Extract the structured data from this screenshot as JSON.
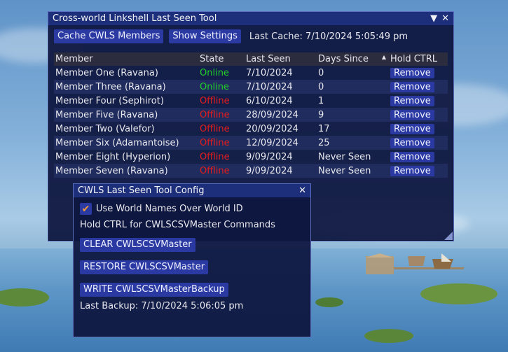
{
  "main_window": {
    "title": "Cross-world Linkshell Last Seen Tool",
    "cache_button": "Cache CWLS Members",
    "settings_button": "Show Settings",
    "last_cache": "Last Cache: 7/10/2024 5:05:49 pm",
    "columns": [
      "Member",
      "State",
      "Last Seen",
      "Days Since",
      "Hold CTRL"
    ],
    "rows": [
      {
        "member": "Member One (Ravana)",
        "state": "Online",
        "last_seen": "7/10/2024",
        "days_since": "0",
        "action": "Remove"
      },
      {
        "member": "Member Three (Ravana)",
        "state": "Online",
        "last_seen": "7/10/2024",
        "days_since": "0",
        "action": "Remove"
      },
      {
        "member": "Member Four (Sephirot)",
        "state": "Offline",
        "last_seen": "6/10/2024",
        "days_since": "1",
        "action": "Remove"
      },
      {
        "member": "Member Five (Ravana)",
        "state": "Offline",
        "last_seen": "28/09/2024",
        "days_since": "9",
        "action": "Remove"
      },
      {
        "member": "Member Two (Valefor)",
        "state": "Offline",
        "last_seen": "20/09/2024",
        "days_since": "17",
        "action": "Remove"
      },
      {
        "member": "Member Six (Adamantoise)",
        "state": "Offline",
        "last_seen": "12/09/2024",
        "days_since": "25",
        "action": "Remove"
      },
      {
        "member": "Member Eight (Hyperion)",
        "state": "Offline",
        "last_seen": "9/09/2024",
        "days_since": "Never Seen",
        "action": "Remove"
      },
      {
        "member": "Member Seven (Ravana)",
        "state": "Offline",
        "last_seen": "9/09/2024",
        "days_since": "Never Seen",
        "action": "Remove"
      }
    ]
  },
  "config_window": {
    "title": "CWLS Last Seen Tool Config",
    "checkbox_label": "Use World Names Over World ID",
    "checkbox_checked": true,
    "hint": "Hold CTRL for CWLSCSVMaster Commands",
    "clear_button": "CLEAR CWLSCSVMaster",
    "restore_button": "RESTORE CWLSCSVMaster",
    "write_button": "WRITE CWLSCSVMasterBackup",
    "last_backup": "Last Backup: 7/10/2024 5:06:05 pm"
  },
  "colors": {
    "online": "#22d02a",
    "offline": "#e51c1c",
    "button": "#2b3aa3",
    "titlebar": "#1d2f7a",
    "checkmark": "#ee9a3a"
  },
  "icons": {
    "collapse": "triangle-down-icon",
    "close": "close-icon",
    "sort": "sort-ascending-icon",
    "resize": "resize-grip-icon"
  }
}
